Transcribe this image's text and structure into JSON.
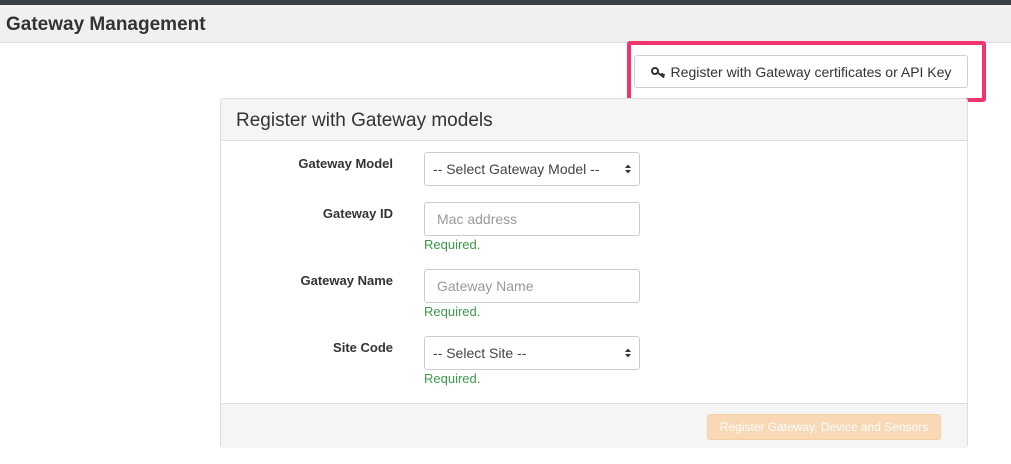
{
  "header": {
    "title": "Gateway Management"
  },
  "toolbar": {
    "cert_button_label": "Register with Gateway certificates or API Key",
    "cert_button_icon": "key-icon",
    "highlight_color": "#f0356d"
  },
  "panel": {
    "title": "Register with Gateway models",
    "fields": {
      "model": {
        "label": "Gateway Model",
        "value": "-- Select Gateway Model --"
      },
      "id": {
        "label": "Gateway ID",
        "placeholder": "Mac address",
        "help": "Required."
      },
      "name": {
        "label": "Gateway Name",
        "placeholder": "Gateway Name",
        "help": "Required."
      },
      "site": {
        "label": "Site Code",
        "value": "-- Select Site --",
        "help": "Required."
      }
    },
    "submit_label": "Register Gateway, Device and Sensors",
    "submit_color": "#f8d8b5"
  }
}
